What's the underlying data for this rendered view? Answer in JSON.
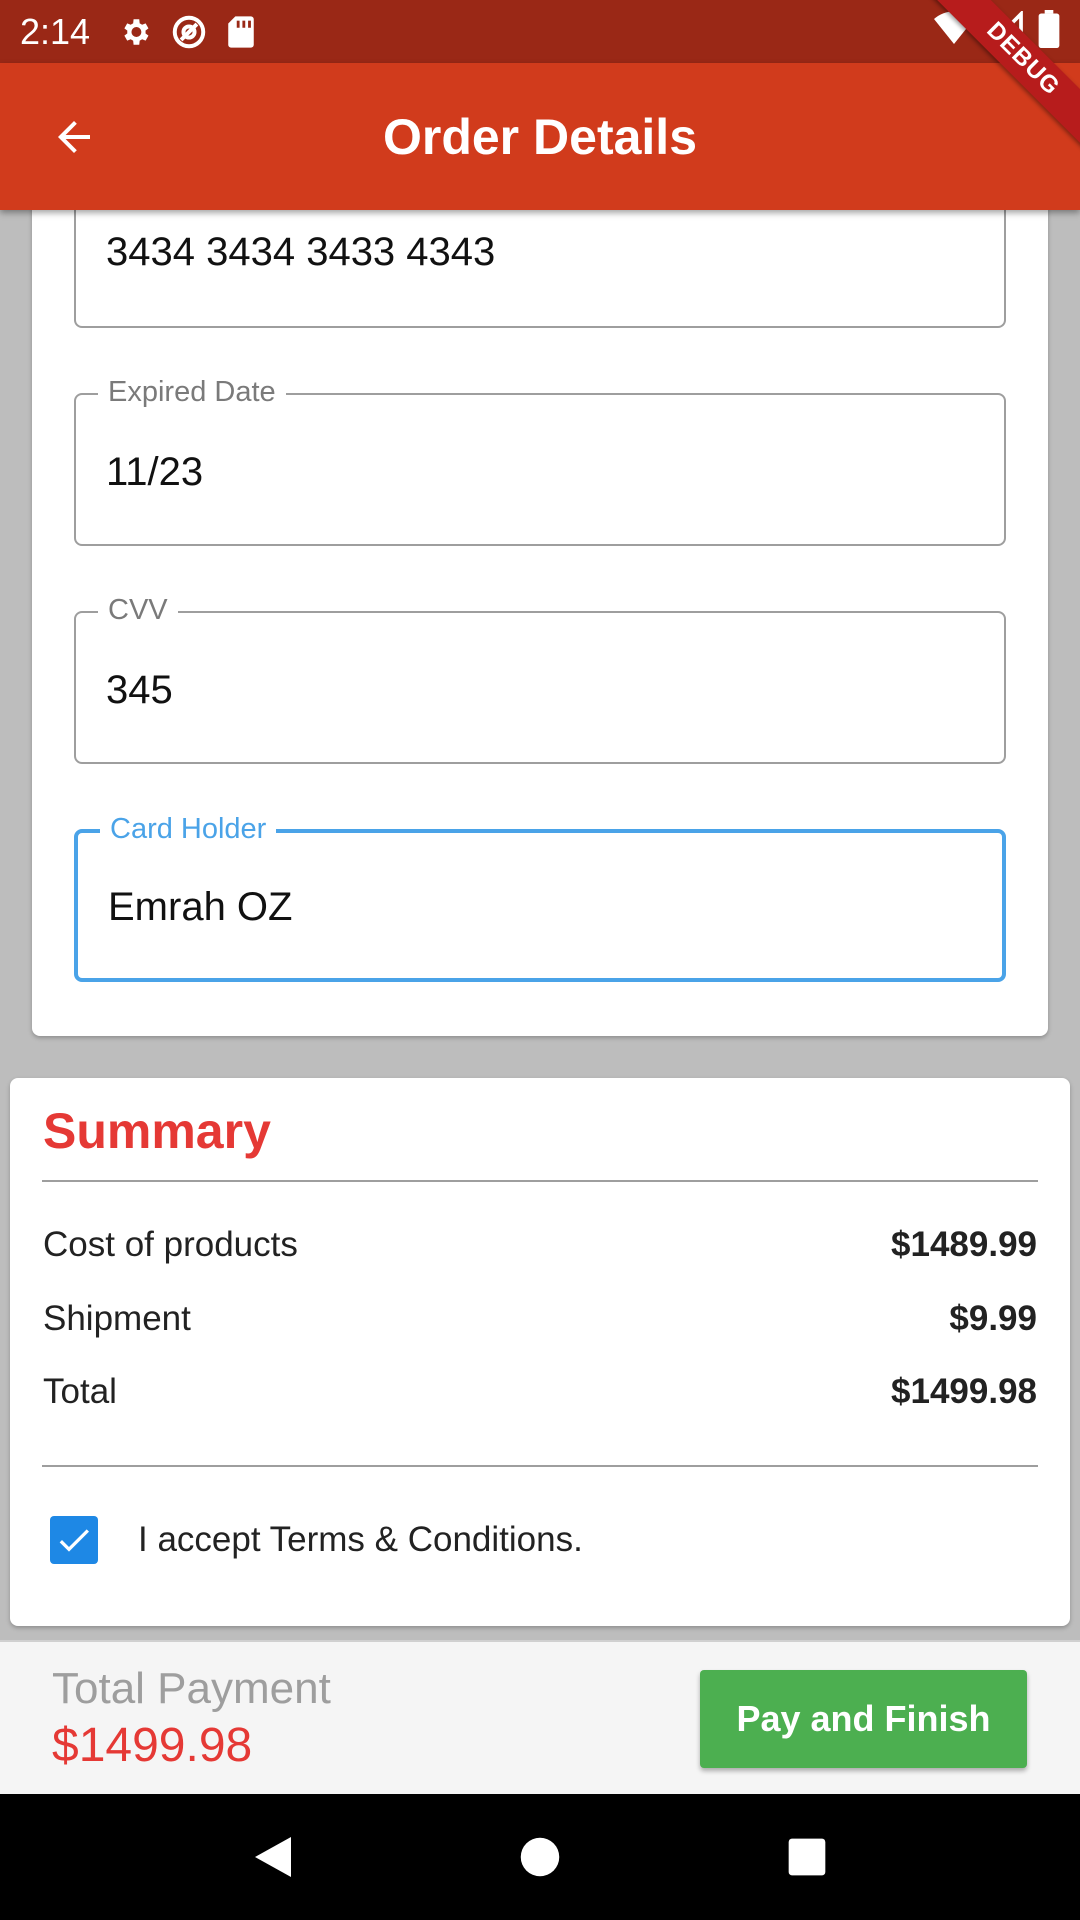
{
  "status_bar": {
    "time": "2:14",
    "icons": [
      "settings-icon",
      "data-saver-icon",
      "sd-card-icon",
      "wifi-icon",
      "signal-icon",
      "battery-icon"
    ]
  },
  "app_bar": {
    "title": "Order Details",
    "back_icon": "arrow-left-icon",
    "color": "#d13b1c"
  },
  "debug_banner": "DEBUG",
  "form": {
    "card_number": {
      "value": "3434 3434 3433 4343"
    },
    "expired_date": {
      "label": "Expired Date",
      "value": "11/23"
    },
    "cvv": {
      "label": "CVV",
      "value": "345"
    },
    "card_holder": {
      "label": "Card Holder",
      "value": "Emrah OZ",
      "focused": true
    }
  },
  "summary": {
    "title": "Summary",
    "rows": [
      {
        "label": "Cost of products",
        "amount": "$1489.99"
      },
      {
        "label": "Shipment",
        "amount": "$9.99"
      },
      {
        "label": "Total",
        "amount": "$1499.98"
      }
    ],
    "terms": {
      "label": "I accept Terms & Conditions.",
      "checked": true
    }
  },
  "bottom": {
    "total_label": "Total Payment",
    "total_value": "$1499.98",
    "pay_button": "Pay and Finish",
    "pay_color": "#4caf50"
  },
  "nav": {
    "buttons": [
      "back-triangle-icon",
      "home-circle-icon",
      "recents-square-icon"
    ]
  }
}
